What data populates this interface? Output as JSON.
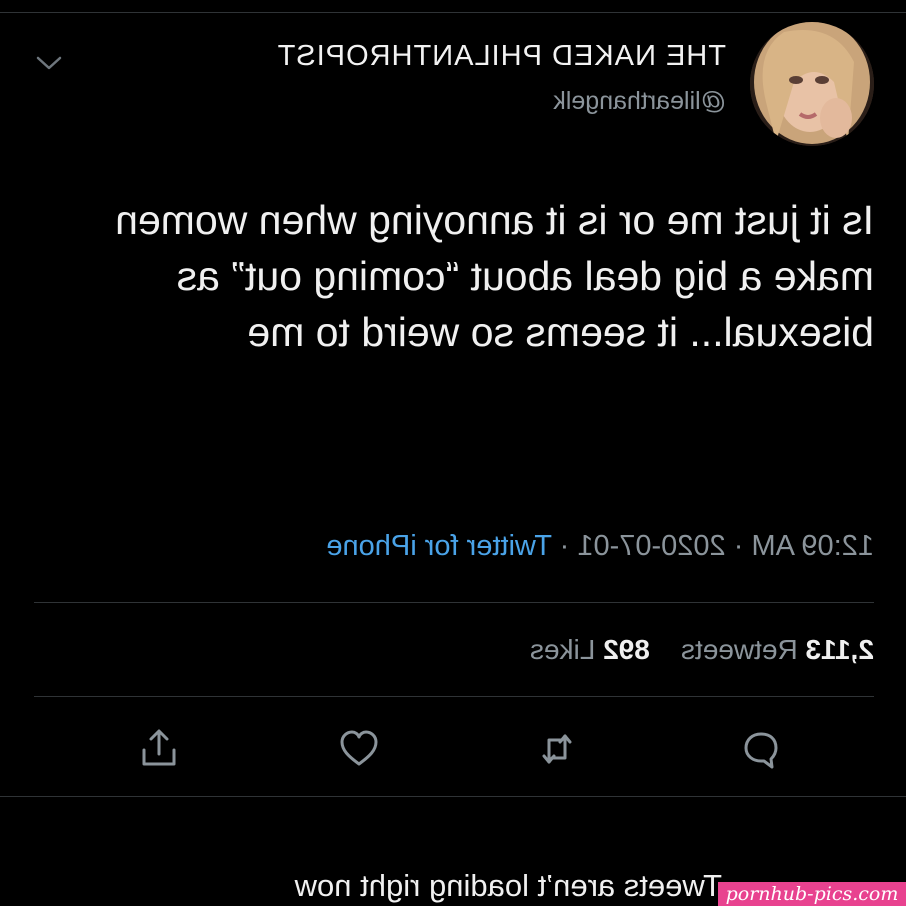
{
  "tweet": {
    "display_name": "THE NAKED PHILANTHROPIST",
    "handle": "@lilearthangelk",
    "text": "Is it just me or is it annoying when women make a big deal about “coming out” as bisexual... it seems so weird to me",
    "time": "12:09 AM",
    "date": "2020-07-01",
    "source": "Twitter for iPhone",
    "separator": "·",
    "retweets_count": "2,113",
    "retweets_label": "Retweets",
    "likes_count": "892",
    "likes_label": "Likes"
  },
  "actions": [
    {
      "icon": "reply-icon"
    },
    {
      "icon": "retweet-icon"
    },
    {
      "icon": "like-icon"
    },
    {
      "icon": "share-icon"
    }
  ],
  "footer": {
    "message": "Tweets aren’t loading right now"
  },
  "watermark": {
    "text": "pornhub-pics.com"
  },
  "colors": {
    "background": "#000000",
    "text": "#f0f0f0",
    "secondary": "#8b949b",
    "link": "#4aa3e8",
    "watermark_bg": "#e8428f"
  }
}
